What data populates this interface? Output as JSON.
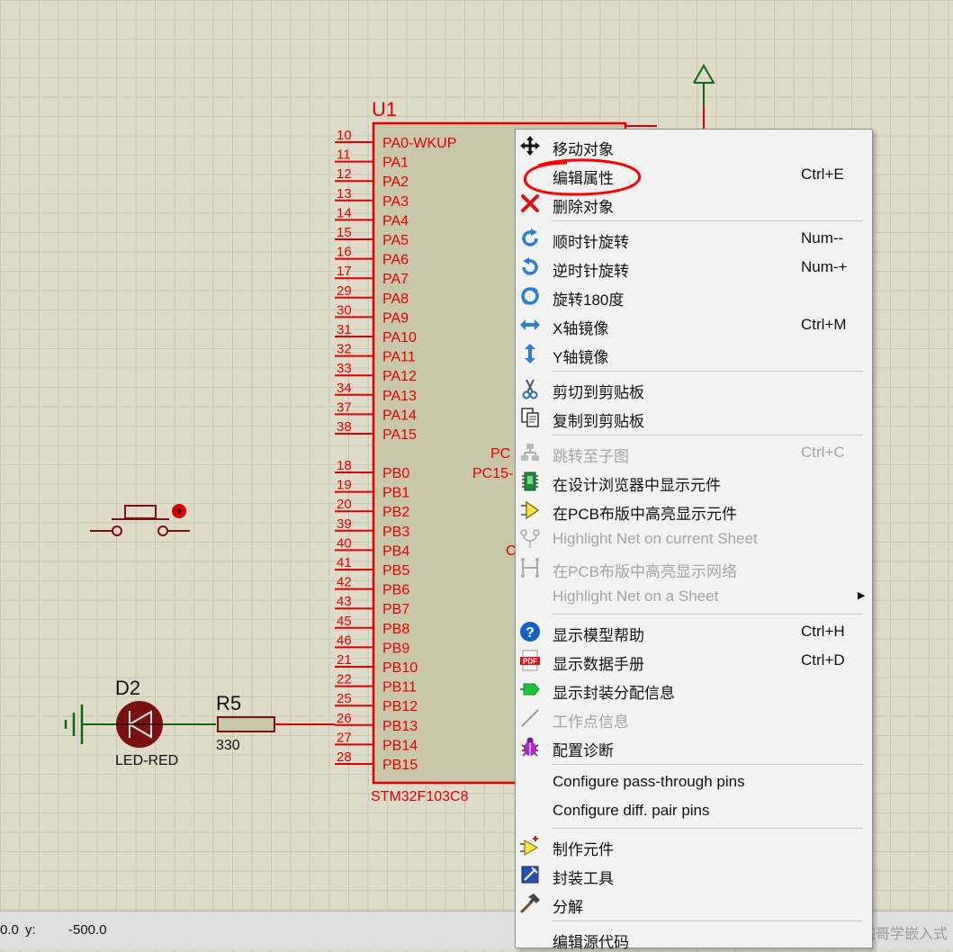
{
  "schematic": {
    "chip": {
      "ref": "U1",
      "part": "STM32F103C8",
      "pins": [
        {
          "num": "10",
          "name": "PA0-WKUP"
        },
        {
          "num": "11",
          "name": "PA1"
        },
        {
          "num": "12",
          "name": "PA2"
        },
        {
          "num": "13",
          "name": "PA3"
        },
        {
          "num": "14",
          "name": "PA4"
        },
        {
          "num": "15",
          "name": "PA5"
        },
        {
          "num": "16",
          "name": "PA6"
        },
        {
          "num": "17",
          "name": "PA7"
        },
        {
          "num": "29",
          "name": "PA8"
        },
        {
          "num": "30",
          "name": "PA9"
        },
        {
          "num": "31",
          "name": "PA10"
        },
        {
          "num": "32",
          "name": "PA11"
        },
        {
          "num": "33",
          "name": "PA12"
        },
        {
          "num": "34",
          "name": "PA13"
        },
        {
          "num": "37",
          "name": "PA14"
        },
        {
          "num": "38",
          "name": "PA15"
        },
        {
          "num": "18",
          "name": "PB0"
        },
        {
          "num": "19",
          "name": "PB1"
        },
        {
          "num": "20",
          "name": "PB2"
        },
        {
          "num": "39",
          "name": "PB3"
        },
        {
          "num": "40",
          "name": "PB4"
        },
        {
          "num": "41",
          "name": "PB5"
        },
        {
          "num": "42",
          "name": "PB6"
        },
        {
          "num": "43",
          "name": "PB7"
        },
        {
          "num": "45",
          "name": "PB8"
        },
        {
          "num": "46",
          "name": "PB9"
        },
        {
          "num": "21",
          "name": "PB10"
        },
        {
          "num": "22",
          "name": "PB11"
        },
        {
          "num": "25",
          "name": "PB12"
        },
        {
          "num": "26",
          "name": "PB13"
        },
        {
          "num": "27",
          "name": "PB14"
        },
        {
          "num": "28",
          "name": "PB15"
        }
      ],
      "right_pin_labels": [
        "PC",
        "PC15-",
        "C"
      ]
    },
    "led": {
      "ref": "D2",
      "value": "LED-RED"
    },
    "resistor": {
      "ref": "R5",
      "value": "330"
    }
  },
  "statusbar": {
    "x_value": "0.0",
    "y_label": "y:",
    "y_value": "-500.0"
  },
  "watermark": "CSDN @跟着杰哥学嵌入式",
  "context_menu": {
    "items": [
      {
        "icon": "move-icon",
        "label": "移动对象",
        "shortcut": "",
        "enabled": true
      },
      {
        "icon": "edit-icon",
        "label": "编辑属性",
        "shortcut": "Ctrl+E",
        "enabled": true
      },
      {
        "icon": "delete-icon",
        "label": "删除对象",
        "shortcut": "",
        "enabled": true
      },
      {
        "icon": "rotate-cw-icon",
        "label": "顺时针旋转",
        "shortcut": "Num--",
        "enabled": true
      },
      {
        "icon": "rotate-ccw-icon",
        "label": "逆时针旋转",
        "shortcut": "Num-+",
        "enabled": true
      },
      {
        "icon": "rotate-180-icon",
        "label": "旋转180度",
        "shortcut": "",
        "enabled": true
      },
      {
        "icon": "mirror-x-icon",
        "label": "X轴镜像",
        "shortcut": "Ctrl+M",
        "enabled": true
      },
      {
        "icon": "mirror-y-icon",
        "label": "Y轴镜像",
        "shortcut": "",
        "enabled": true
      },
      {
        "icon": "scissors-icon",
        "label": "剪切到剪贴板",
        "shortcut": "",
        "enabled": true
      },
      {
        "icon": "copy-icon",
        "label": "复制到剪贴板",
        "shortcut": "",
        "enabled": true
      },
      {
        "icon": "hierarchy-icon",
        "label": "跳转至子图",
        "shortcut": "Ctrl+C",
        "enabled": false
      },
      {
        "icon": "chip-browser-icon",
        "label": "在设计浏览器中显示元件",
        "shortcut": "",
        "enabled": true
      },
      {
        "icon": "highlight-arrow-icon",
        "label": "在PCB布版中高亮显示元件",
        "shortcut": "",
        "enabled": true
      },
      {
        "icon": "net-icon",
        "label": "Highlight Net on current Sheet",
        "shortcut": "",
        "enabled": false
      },
      {
        "icon": "pcb-net-icon",
        "label": "在PCB布版中高亮显示网络",
        "shortcut": "",
        "enabled": false
      },
      {
        "icon": "",
        "label": "Highlight Net on a Sheet",
        "shortcut": "",
        "enabled": false,
        "submenu": true
      },
      {
        "icon": "help-icon",
        "label": "显示模型帮助",
        "shortcut": "Ctrl+H",
        "enabled": true
      },
      {
        "icon": "pdf-icon",
        "label": "显示数据手册",
        "shortcut": "Ctrl+D",
        "enabled": true
      },
      {
        "icon": "package-icon",
        "label": "显示封装分配信息",
        "shortcut": "",
        "enabled": true
      },
      {
        "icon": "line-icon",
        "label": "工作点信息",
        "shortcut": "",
        "enabled": false
      },
      {
        "icon": "bug-icon",
        "label": "配置诊断",
        "shortcut": "",
        "enabled": true
      },
      {
        "icon": "",
        "label": "Configure pass-through pins",
        "shortcut": "",
        "enabled": true
      },
      {
        "icon": "",
        "label": "Configure diff. pair pins",
        "shortcut": "",
        "enabled": true
      },
      {
        "icon": "make-device-icon",
        "label": "制作元件",
        "shortcut": "",
        "enabled": true
      },
      {
        "icon": "package-tool-icon",
        "label": "封装工具",
        "shortcut": "",
        "enabled": true
      },
      {
        "icon": "hammer-icon",
        "label": "分解",
        "shortcut": "",
        "enabled": true
      },
      {
        "icon": "",
        "label": "编辑源代码",
        "shortcut": "",
        "enabled": true
      }
    ]
  },
  "colors": {
    "canvas": "#dedbc9",
    "grid": "#c9c6b3",
    "pin": "#e00000",
    "chip_body": "#c8c8a8",
    "component": "#7a1010",
    "wire_green": "#116611",
    "annotation": "#ff0000"
  }
}
